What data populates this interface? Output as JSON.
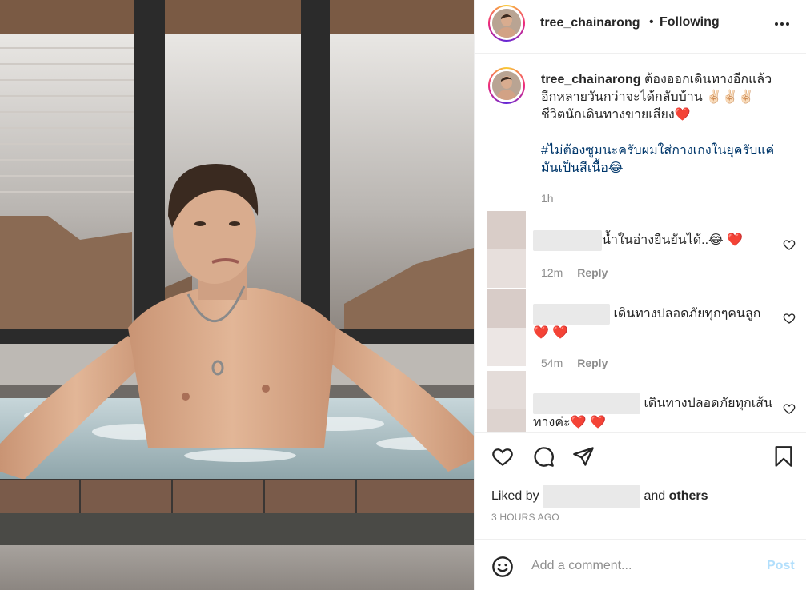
{
  "post": {
    "username": "tree_chainarong",
    "separator": "•",
    "follow_status": "Following",
    "more_icon": "more-horizontal-icon"
  },
  "caption": {
    "username": "tree_chainarong",
    "text": "ต้องออกเดินทางอีกแล้ว อีกหลายวันกว่าจะได้กลับบ้าน ✌🏻✌🏻✌🏻 ชีวิตนักเดินทางขายเสียง❤️",
    "hashtag_text": "#ไม่ต้องซูมนะครับผมใส่กางเกงในยุครับแค่มันเป็นสีเนื้อ😂",
    "time": "1h"
  },
  "comments": [
    {
      "text": "น้ำในอ่างยืนยันได้..😂 ❤️",
      "time": "12m",
      "reply": "Reply"
    },
    {
      "text": "เดินทางปลอดภัยทุกๆคนลูก❤️ ❤️",
      "time": "54m",
      "reply": "Reply"
    },
    {
      "text": "เดินทางปลอดภัยทุกเส้นทางค่ะ❤️ ❤️",
      "time": "",
      "reply": ""
    }
  ],
  "actions": {
    "like_icon": "heart-icon",
    "comment_icon": "comment-icon",
    "share_icon": "send-icon",
    "save_icon": "bookmark-icon"
  },
  "likes": {
    "prefix": "Liked by",
    "suffix_and": "and",
    "suffix_others": "others"
  },
  "posted_ago": "3 HOURS AGO",
  "add_comment": {
    "placeholder": "Add a comment...",
    "post_label": "Post",
    "emoji_icon": "smiley-icon"
  },
  "colors": {
    "link": "#00376b",
    "secondary": "#8e8e8e",
    "post_disabled": "#b2dffc",
    "heart_red": "#ed4956"
  }
}
